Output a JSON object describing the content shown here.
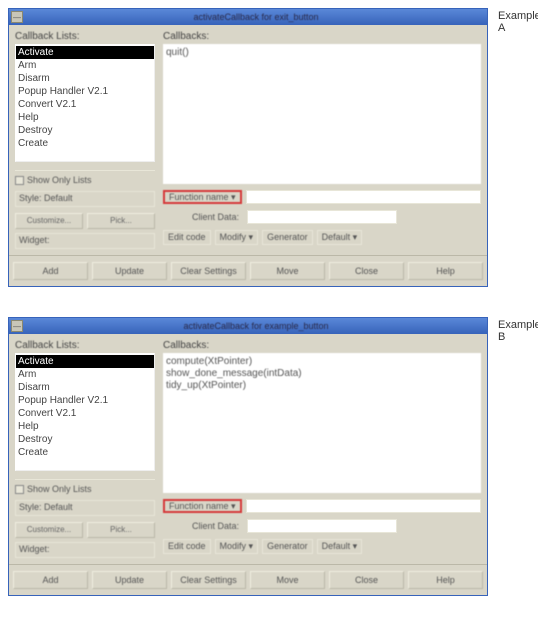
{
  "examples": {
    "a_label": "Example A",
    "b_label": "Example B"
  },
  "dialogA": {
    "title": "activateCallback for exit_button",
    "callback_lists_label": "Callback Lists:",
    "callbacks_label": "Callbacks:",
    "list_items": [
      "Activate",
      "Arm",
      "Disarm",
      "Popup Handler V2.1",
      "Convert V2.1",
      "Help",
      "Destroy",
      "Create"
    ],
    "selected_index": 0,
    "callbacks_content": [
      "quit()"
    ],
    "showonly_label": "Show Only Lists",
    "style_label": "Style:  Default",
    "customize_btn": "Customize...",
    "pick_btn": "Pick...",
    "widget_label": "Widget:",
    "func_name_btn": "Function name ▾",
    "func_name_val": "",
    "client_data_label": "Client Data:",
    "client_data_val": "",
    "editcode_btn": "Edit code",
    "modify_btn": "Modify ▾",
    "generator_btn": "Generator",
    "default_btn": "Default ▾",
    "bottom": [
      "Add",
      "Update",
      "Clear Settings",
      "Move",
      "Close",
      "Help"
    ]
  },
  "dialogB": {
    "title": "activateCallback for example_button",
    "callback_lists_label": "Callback Lists:",
    "callbacks_label": "Callbacks:",
    "list_items": [
      "Activate",
      "Arm",
      "Disarm",
      "Popup Handler V2.1",
      "Convert V2.1",
      "Help",
      "Destroy",
      "Create"
    ],
    "selected_index": 0,
    "callbacks_content": [
      "compute(XtPointer)",
      "show_done_message(intData)",
      "tidy_up(XtPointer)"
    ],
    "showonly_label": "Show Only Lists",
    "style_label": "Style:  Default",
    "customize_btn": "Customize...",
    "pick_btn": "Pick...",
    "widget_label": "Widget:",
    "func_name_btn": "Function name ▾",
    "func_name_val": "",
    "client_data_label": "Client Data:",
    "client_data_val": "",
    "editcode_btn": "Edit code",
    "modify_btn": "Modify ▾",
    "generator_btn": "Generator",
    "default_btn": "Default ▾",
    "bottom": [
      "Add",
      "Update",
      "Clear Settings",
      "Move",
      "Close",
      "Help"
    ]
  }
}
